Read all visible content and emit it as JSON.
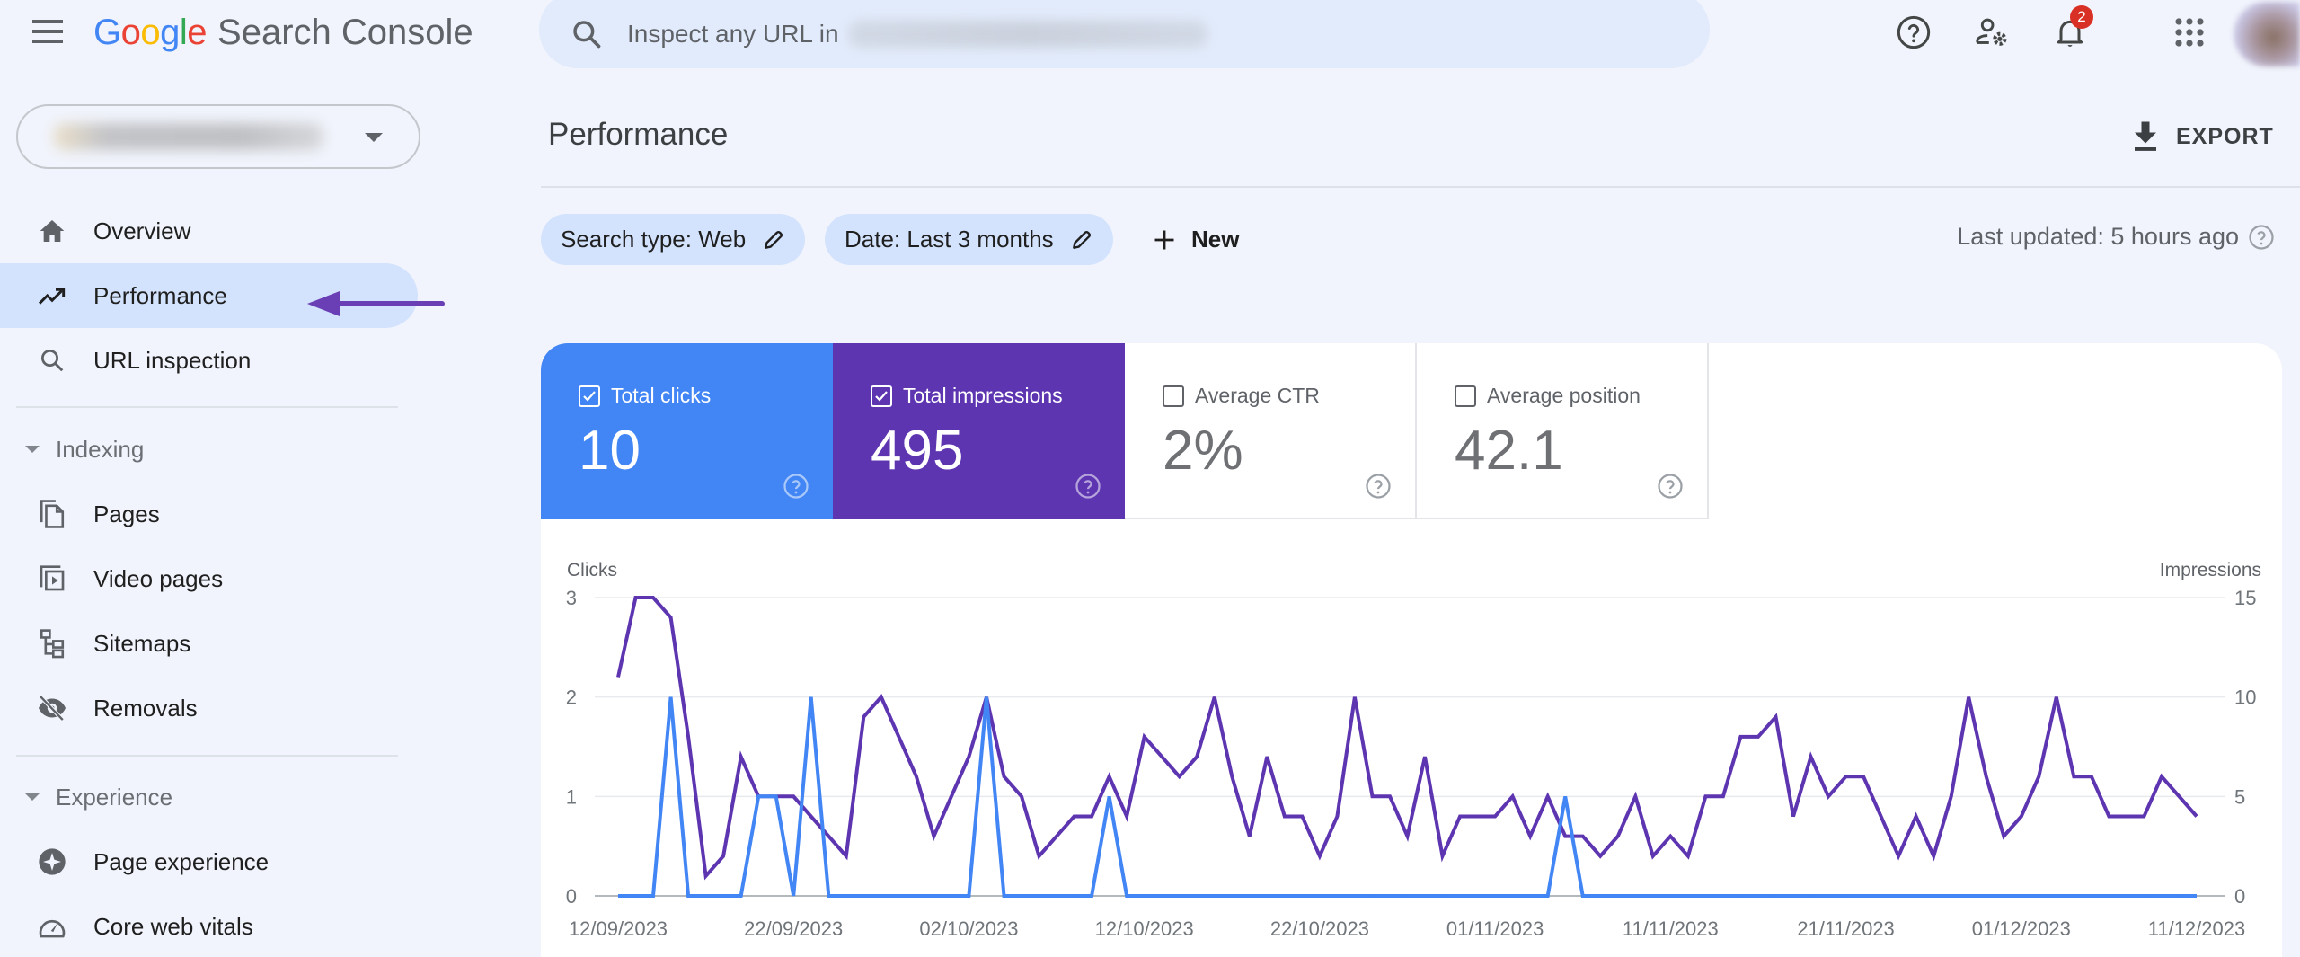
{
  "app": {
    "logo_google": [
      "G",
      "o",
      "o",
      "g",
      "l",
      "e"
    ],
    "logo_colors": [
      "#4285f4",
      "#ea4335",
      "#fbbc05",
      "#4285f4",
      "#34a853",
      "#ea4335"
    ],
    "product_name": "Search Console"
  },
  "search": {
    "placeholder": "Inspect any URL in",
    "icon": "search-icon"
  },
  "topbar": {
    "icons": [
      "help-icon",
      "admin-settings-icon",
      "notifications-icon",
      "apps-grid-icon"
    ],
    "notification_count": "2"
  },
  "sidebar": {
    "property_selector": {
      "icon": "chevron-down-icon"
    },
    "items": [
      {
        "label": "Overview",
        "icon": "home-icon",
        "active": false
      },
      {
        "label": "Performance",
        "icon": "trending-up-icon",
        "active": true
      },
      {
        "label": "URL inspection",
        "icon": "search-icon",
        "active": false
      }
    ],
    "sections": [
      {
        "title": "Indexing",
        "items": [
          {
            "label": "Pages",
            "icon": "pages-icon"
          },
          {
            "label": "Video pages",
            "icon": "video-pages-icon"
          },
          {
            "label": "Sitemaps",
            "icon": "sitemap-icon"
          },
          {
            "label": "Removals",
            "icon": "eye-off-icon"
          }
        ]
      },
      {
        "title": "Experience",
        "items": [
          {
            "label": "Page experience",
            "icon": "page-experience-icon"
          },
          {
            "label": "Core web vitals",
            "icon": "speedometer-icon"
          }
        ]
      }
    ],
    "annotation_arrow_color": "#6a3fb5"
  },
  "main": {
    "title": "Performance",
    "export_label": "EXPORT",
    "filters": [
      {
        "label": "Search type: Web"
      },
      {
        "label": "Date: Last 3 months"
      }
    ],
    "new_label": "New",
    "last_updated": "Last updated: 5 hours ago",
    "metrics": [
      {
        "label": "Total clicks",
        "value": "10",
        "checked": true,
        "color": "#4285f4"
      },
      {
        "label": "Total impressions",
        "value": "495",
        "checked": true,
        "color": "#5e35b1"
      },
      {
        "label": "Average CTR",
        "value": "2%",
        "checked": false
      },
      {
        "label": "Average position",
        "value": "42.1",
        "checked": false
      }
    ]
  },
  "chart_data": {
    "type": "line",
    "title": "",
    "start_date": "12/09/2023",
    "end_date": "11/12/2023",
    "x_tick_labels": [
      "12/09/2023",
      "22/09/2023",
      "02/10/2023",
      "12/10/2023",
      "22/10/2023",
      "01/11/2023",
      "11/11/2023",
      "21/11/2023",
      "01/12/2023",
      "11/12/2023"
    ],
    "x_tick_step_days": 10,
    "left_axis": {
      "label": "Clicks",
      "ticks": [
        0,
        1,
        2,
        3
      ],
      "range": [
        0,
        3
      ]
    },
    "right_axis": {
      "label": "Impressions",
      "ticks": [
        0,
        5,
        10,
        15
      ],
      "range": [
        0,
        15
      ]
    },
    "grid": true,
    "legend": "none",
    "series": [
      {
        "name": "Clicks",
        "axis": "left",
        "color": "#4285f4",
        "values": [
          0,
          0,
          0,
          2,
          0,
          0,
          0,
          0,
          1,
          1,
          0,
          2,
          0,
          0,
          0,
          0,
          0,
          0,
          0,
          0,
          0,
          2,
          0,
          0,
          0,
          0,
          0,
          0,
          1,
          0,
          0,
          0,
          0,
          0,
          0,
          0,
          0,
          0,
          0,
          0,
          0,
          0,
          0,
          0,
          0,
          0,
          0,
          0,
          0,
          0,
          0,
          0,
          0,
          0,
          1,
          0,
          0,
          0,
          0,
          0,
          0,
          0,
          0,
          0,
          0,
          0,
          0,
          0,
          0,
          0,
          0,
          0,
          0,
          0,
          0,
          0,
          0,
          0,
          0,
          0,
          0,
          0,
          0,
          0,
          0,
          0,
          0,
          0,
          0,
          0,
          0
        ]
      },
      {
        "name": "Impressions",
        "axis": "right",
        "color": "#5e35b1",
        "values": [
          11,
          15,
          15,
          14,
          8,
          1,
          2,
          7,
          5,
          5,
          5,
          4,
          3,
          2,
          9,
          10,
          8,
          6,
          3,
          5,
          7,
          10,
          6,
          5,
          2,
          3,
          4,
          4,
          6,
          4,
          8,
          7,
          6,
          7,
          10,
          6,
          3,
          7,
          4,
          4,
          2,
          4,
          10,
          5,
          5,
          3,
          7,
          2,
          4,
          4,
          4,
          5,
          3,
          5,
          3,
          3,
          2,
          3,
          5,
          2,
          3,
          2,
          5,
          5,
          8,
          8,
          9,
          4,
          7,
          5,
          6,
          6,
          4,
          2,
          4,
          2,
          5,
          10,
          6,
          3,
          4,
          6,
          10,
          6,
          6,
          4,
          4,
          4,
          6,
          5,
          4
        ]
      }
    ]
  }
}
